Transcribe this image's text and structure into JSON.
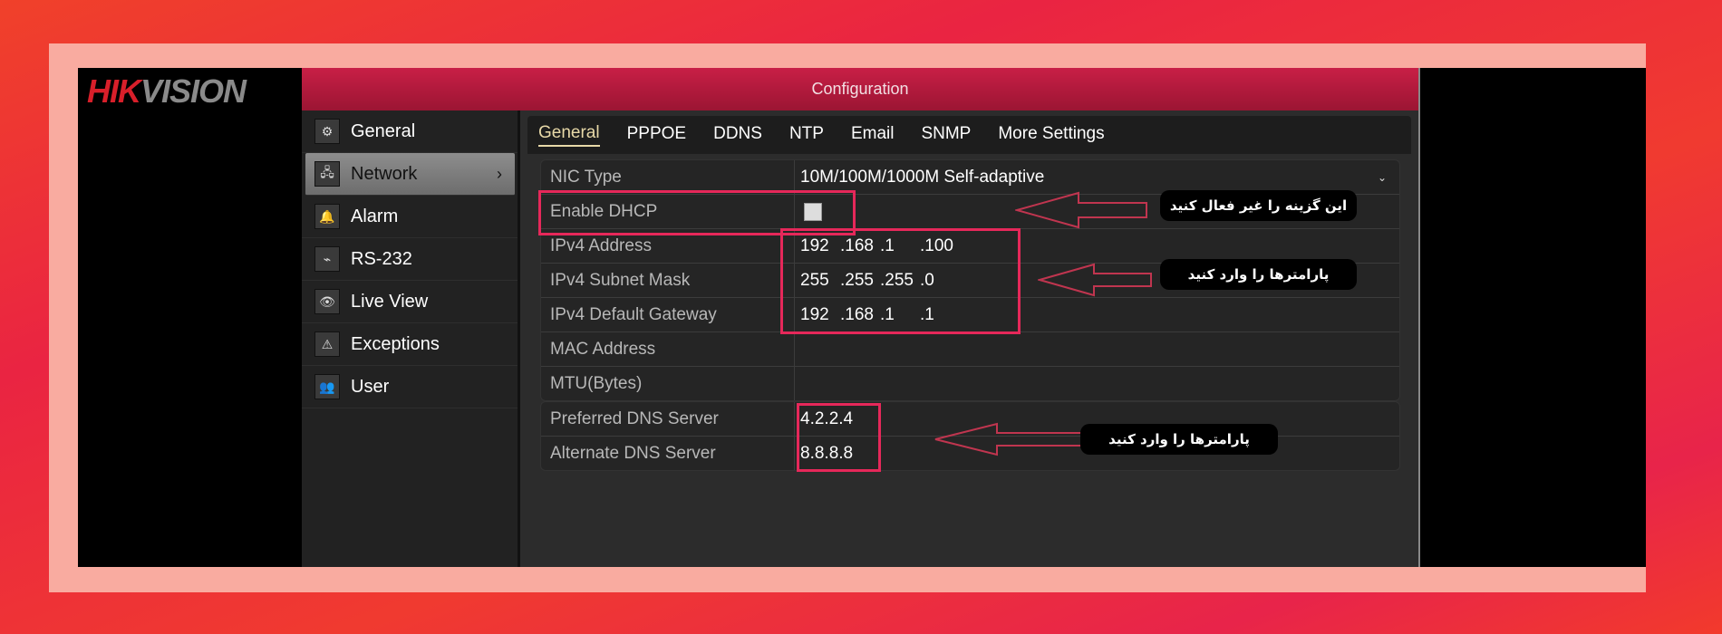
{
  "logo": {
    "part1": "HIK",
    "part2": "VISION"
  },
  "header": {
    "title": "Configuration"
  },
  "sidebar": {
    "items": [
      {
        "label": "General",
        "icon": "⚙"
      },
      {
        "label": "Network",
        "icon": "🖧",
        "active": true,
        "chevron": "›"
      },
      {
        "label": "Alarm",
        "icon": "🔔"
      },
      {
        "label": "RS-232",
        "icon": "⌁"
      },
      {
        "label": "Live View",
        "icon": "👁"
      },
      {
        "label": "Exceptions",
        "icon": "⚠"
      },
      {
        "label": "User",
        "icon": "👥"
      }
    ]
  },
  "tabs": [
    "General",
    "PPPOE",
    "DDNS",
    "NTP",
    "Email",
    "SNMP",
    "More Settings"
  ],
  "form": {
    "nic_type": {
      "label": "NIC Type",
      "value": "10M/100M/1000M Self-adaptive"
    },
    "dhcp": {
      "label": "Enable DHCP",
      "checked": false
    },
    "ipv4_address": {
      "label": "IPv4 Address",
      "octets": [
        "192",
        ".168",
        ".1",
        ".100"
      ]
    },
    "subnet_mask": {
      "label": "IPv4 Subnet Mask",
      "octets": [
        "255",
        ".255",
        ".255",
        ".0"
      ]
    },
    "gateway": {
      "label": "IPv4 Default Gateway",
      "octets": [
        "192",
        ".168",
        ".1",
        ".1"
      ]
    },
    "mac": {
      "label": "MAC Address",
      "value": ""
    },
    "mtu": {
      "label": "MTU(Bytes)",
      "value": ""
    },
    "dns_pref": {
      "label": "Preferred DNS Server",
      "value": "4.2.2.4"
    },
    "dns_alt": {
      "label": "Alternate DNS Server",
      "value": "8.8.8.8"
    }
  },
  "annotations": {
    "dhcp_note": "این گزینه را غیر فعال کنید",
    "ip_note": "پارامترها را وارد کنید",
    "dns_note": "پارامترها را وارد کنید"
  },
  "colors": {
    "highlight": "#e6285a",
    "header": "#c81f46",
    "brand_red": "#d81f2a"
  }
}
